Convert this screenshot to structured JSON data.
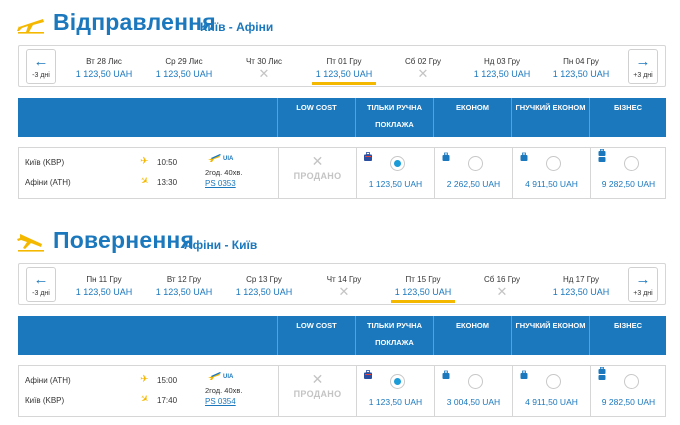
{
  "sections": [
    {
      "title": "Відправлення",
      "route": "Київ - Афіни",
      "prev_label": "-3 дні",
      "next_label": "+3 дні",
      "days": [
        {
          "name": "Вт 28 Лис",
          "price": "1 123,50 UAH",
          "available": true,
          "selected": false
        },
        {
          "name": "Ср 29 Лис",
          "price": "1 123,50 UAH",
          "available": true,
          "selected": false
        },
        {
          "name": "Чт 30 Лис",
          "price": "",
          "available": false,
          "selected": false
        },
        {
          "name": "Пт 01 Гру",
          "price": "1 123,50 UAH",
          "available": true,
          "selected": true
        },
        {
          "name": "Сб 02 Гру",
          "price": "",
          "available": false,
          "selected": false
        },
        {
          "name": "Нд 03 Гру",
          "price": "1 123,50 UAH",
          "available": true,
          "selected": false
        },
        {
          "name": "Пн 04 Гру",
          "price": "1 123,50 UAH",
          "available": true,
          "selected": false
        }
      ],
      "fare_headers": [
        "LOW COST",
        "ТІЛЬКИ РУЧНА",
        "ПОКЛАЖА",
        "ЕКОНОМ",
        "ГНУЧКИЙ ЕКОНОМ",
        "БІЗНЕС"
      ],
      "flight": {
        "from_city": "Київ (KBP)",
        "to_city": "Афіни (ATH)",
        "dep_time": "10:50",
        "arr_time": "13:30",
        "duration": "2год. 40хв.",
        "number": "PS 0353",
        "airline_tag": "UIA",
        "sold_label": "ПРОДАНО",
        "fares": [
          {
            "price": "1 123,50 UAH",
            "selected": true
          },
          {
            "price": "2 262,50 UAH",
            "selected": false
          },
          {
            "price": "4 911,50 UAH",
            "selected": false
          },
          {
            "price": "9 282,50 UAH",
            "selected": false
          }
        ]
      }
    },
    {
      "title": "Повернення",
      "route": "Афіни - Київ",
      "prev_label": "-3 дні",
      "next_label": "+3 дні",
      "days": [
        {
          "name": "Пн 11 Гру",
          "price": "1 123,50 UAH",
          "available": true,
          "selected": false
        },
        {
          "name": "Вт 12 Гру",
          "price": "1 123,50 UAH",
          "available": true,
          "selected": false
        },
        {
          "name": "Ср 13 Гру",
          "price": "1 123,50 UAH",
          "available": true,
          "selected": false
        },
        {
          "name": "Чт 14 Гру",
          "price": "",
          "available": false,
          "selected": false
        },
        {
          "name": "Пт 15 Гру",
          "price": "1 123,50 UAH",
          "available": true,
          "selected": true
        },
        {
          "name": "Сб 16 Гру",
          "price": "",
          "available": false,
          "selected": false
        },
        {
          "name": "Нд 17 Гру",
          "price": "1 123,50 UAH",
          "available": true,
          "selected": false
        }
      ],
      "fare_headers": [
        "LOW COST",
        "ТІЛЬКИ РУЧНА",
        "ПОКЛАЖА",
        "ЕКОНОМ",
        "ГНУЧКИЙ ЕКОНОМ",
        "БІЗНЕС"
      ],
      "flight": {
        "from_city": "Афіни (ATH)",
        "to_city": "Київ (KBP)",
        "dep_time": "15:00",
        "arr_time": "17:40",
        "duration": "2год. 40хв.",
        "number": "PS 0354",
        "airline_tag": "UIA",
        "sold_label": "ПРОДАНО",
        "fares": [
          {
            "price": "1 123,50 UAH",
            "selected": true
          },
          {
            "price": "3 004,50 UAH",
            "selected": false
          },
          {
            "price": "4 911,50 UAH",
            "selected": false
          },
          {
            "price": "9 282,50 UAH",
            "selected": false
          }
        ]
      }
    }
  ],
  "colors": {
    "primary": "#1b78bd",
    "accent": "#f5b800",
    "radio_selected": "#1b9bd8",
    "muted": "#c4c4c4"
  },
  "icons": {
    "section_logo": "departing-plane-icon",
    "prev": "arrow-left-icon",
    "next": "arrow-right-icon",
    "unavailable": "cross-icon",
    "depart": "takeoff-icon",
    "arrive": "landing-icon",
    "baggage": "suitcase-icon"
  }
}
